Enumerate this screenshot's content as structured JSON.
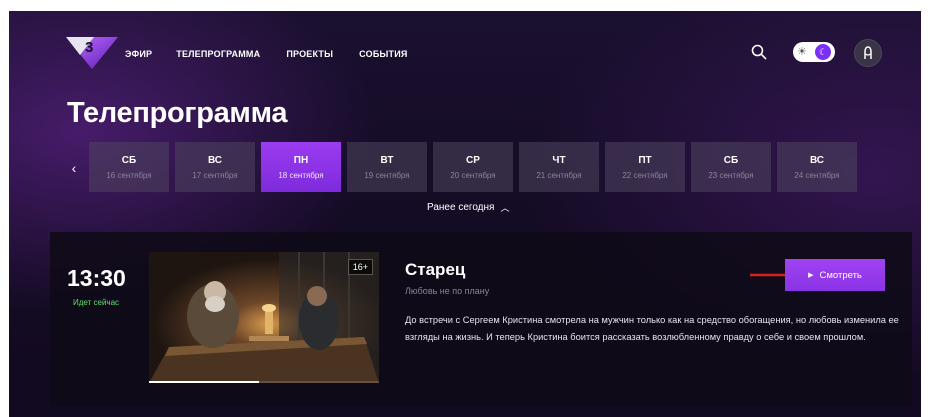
{
  "header": {
    "nav": [
      "ЭФИР",
      "ТЕЛЕПРОГРАММА",
      "ПРОЕКТЫ",
      "СОБЫТИЯ"
    ],
    "logo_text": "3"
  },
  "page_title": "Телепрограмма",
  "days": [
    {
      "name": "СБ",
      "date": "16 сентября",
      "active": false
    },
    {
      "name": "ВС",
      "date": "17 сентября",
      "active": false
    },
    {
      "name": "ПН",
      "date": "18 сентября",
      "active": true
    },
    {
      "name": "ВТ",
      "date": "19 сентября",
      "active": false
    },
    {
      "name": "СР",
      "date": "20 сентября",
      "active": false
    },
    {
      "name": "ЧТ",
      "date": "21 сентября",
      "active": false
    },
    {
      "name": "ПТ",
      "date": "22 сентября",
      "active": false
    },
    {
      "name": "СБ",
      "date": "23 сентября",
      "active": false
    },
    {
      "name": "ВС",
      "date": "24 сентября",
      "active": false
    }
  ],
  "earlier_label": "Ранее сегодня",
  "program": {
    "time": "13:30",
    "status": "Идет сейчас",
    "age_rating": "16+",
    "title": "Старец",
    "subtitle": "Любовь не по плану",
    "description": "До встречи с Сергеем Кристина смотрела на мужчин только как на средство обогащения, но любовь изменила ее взгляды на жизнь. И теперь Кристина боится рассказать возлюбленному правду о себе и своем прошлом.",
    "watch_label": "Смотреть",
    "progress": 0.48
  },
  "colors": {
    "accent": "#8a33e6",
    "live_status": "#5fe06a",
    "annotation_arrow": "#d8231b"
  }
}
